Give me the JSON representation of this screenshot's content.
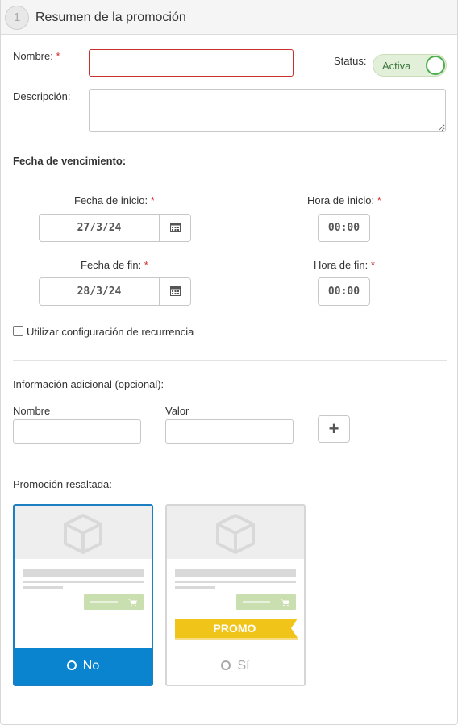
{
  "header": {
    "step": "1",
    "title": "Resumen de la promoción"
  },
  "form": {
    "nombre_label": "Nombre:",
    "required_mark": "*",
    "nombre_value": "",
    "status_label": "Status:",
    "status_toggle": "Activa",
    "descripcion_label": "Descripción:",
    "descripcion_value": ""
  },
  "fecha": {
    "section_title": "Fecha de vencimiento:",
    "inicio_label": "Fecha de inicio:",
    "inicio_value": "27/3/24",
    "hora_inicio_label": "Hora de inicio:",
    "hora_inicio_value": "00:00",
    "fin_label": "Fecha de fin:",
    "fin_value": "28/3/24",
    "hora_fin_label": "Hora de fin:",
    "hora_fin_value": "00:00",
    "recurrence_label": "Utilizar configuración de recurrencia"
  },
  "info": {
    "title": "Información adicional (opcional):",
    "nombre_label": "Nombre",
    "valor_label": "Valor",
    "nombre_value": "",
    "valor_value": "",
    "add_symbol": "+"
  },
  "promo": {
    "title": "Promoción resaltada:",
    "option_no": "No",
    "option_si": "Sí",
    "ribbon_text": "PROMO",
    "selected": "No"
  },
  "icons": {
    "calendar": "calendar-icon",
    "box": "box-icon",
    "cart": "cart-icon",
    "plus": "plus-icon"
  },
  "colors": {
    "required": "#c9302c",
    "toggle_bg": "#e2efd9",
    "toggle_accent": "#4cae4c",
    "selected_blue": "#0a84cf",
    "promo_yellow": "#f0c419",
    "cart_green": "#c9dfb0"
  }
}
